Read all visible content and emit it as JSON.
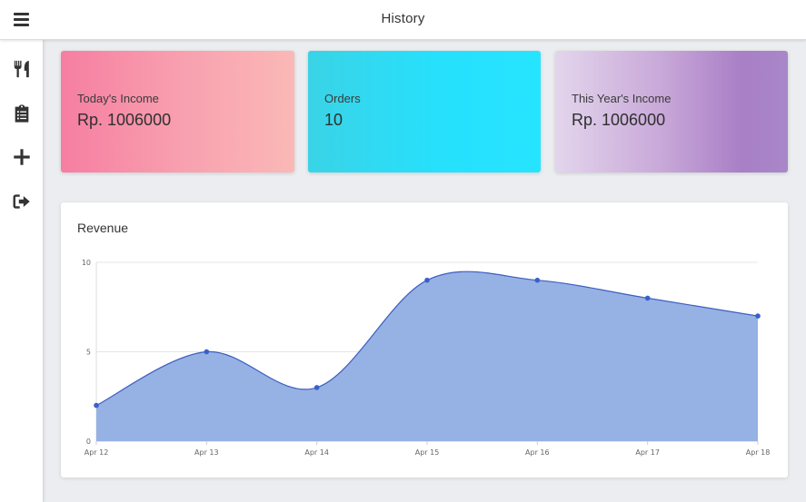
{
  "header": {
    "title": "History"
  },
  "sidebar": {
    "items": [
      {
        "icon": "utensils-icon"
      },
      {
        "icon": "clipboard-icon"
      },
      {
        "icon": "plus-icon"
      },
      {
        "icon": "sign-out-icon"
      }
    ]
  },
  "cards": [
    {
      "label": "Today's Income",
      "value": "Rp. 1006000"
    },
    {
      "label": "Orders",
      "value": "10"
    },
    {
      "label": "This Year's Income",
      "value": "Rp. 1006000"
    }
  ],
  "revenue": {
    "title": "Revenue"
  },
  "colors": {
    "area_fill": "#96b1e3",
    "line": "#3b5fc0",
    "point": "#3a5fcc"
  },
  "chart_data": {
    "type": "area",
    "title": "Revenue",
    "categories": [
      "Apr 12",
      "Apr 13",
      "Apr 14",
      "Apr 15",
      "Apr 16",
      "Apr 17",
      "Apr 18"
    ],
    "series": [
      {
        "values": [
          2,
          5,
          3,
          9,
          9,
          8,
          7
        ]
      }
    ],
    "ylim": [
      0,
      10
    ],
    "yticks": [
      0,
      5,
      10
    ],
    "grid": true,
    "smooth": true
  }
}
